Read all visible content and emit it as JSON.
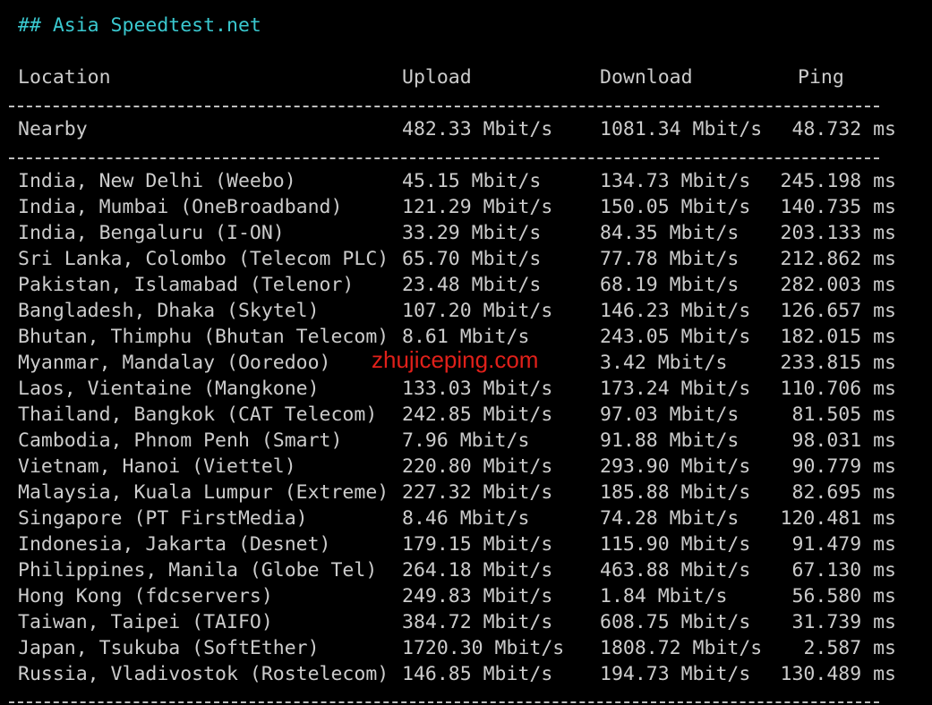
{
  "heading": "## Asia Speedtest.net",
  "columns": {
    "location": "Location",
    "upload": "Upload",
    "download": "Download",
    "ping": "Ping"
  },
  "separator": "---------------------------------------------------------------------------------",
  "nearby": {
    "location": "Nearby",
    "upload": "482.33 Mbit/s",
    "download": "1081.34 Mbit/s",
    "ping": "48.732 ms"
  },
  "rows": [
    {
      "location": "India, New Delhi (Weebo)",
      "upload": "45.15 Mbit/s",
      "download": "134.73 Mbit/s",
      "ping": "245.198 ms"
    },
    {
      "location": "India, Mumbai (OneBroadband)",
      "upload": "121.29 Mbit/s",
      "download": "150.05 Mbit/s",
      "ping": "140.735 ms"
    },
    {
      "location": "India, Bengaluru (I-ON)",
      "upload": "33.29 Mbit/s",
      "download": "84.35 Mbit/s",
      "ping": "203.133 ms"
    },
    {
      "location": "Sri Lanka, Colombo (Telecom PLC)",
      "upload": "65.70 Mbit/s",
      "download": "77.78 Mbit/s",
      "ping": "212.862 ms"
    },
    {
      "location": "Pakistan, Islamabad (Telenor)",
      "upload": "23.48 Mbit/s",
      "download": "68.19 Mbit/s",
      "ping": "282.003 ms"
    },
    {
      "location": "Bangladesh, Dhaka (Skytel)",
      "upload": "107.20 Mbit/s",
      "download": "146.23 Mbit/s",
      "ping": "126.657 ms"
    },
    {
      "location": "Bhutan, Thimphu (Bhutan Telecom)",
      "upload": "8.61 Mbit/s",
      "download": "243.05 Mbit/s",
      "ping": "182.015 ms"
    },
    {
      "location": "Myanmar, Mandalay (Ooredoo)",
      "upload": "",
      "download": "3.42 Mbit/s",
      "ping": "233.815 ms"
    },
    {
      "location": "Laos, Vientaine (Mangkone)",
      "upload": "133.03 Mbit/s",
      "download": "173.24 Mbit/s",
      "ping": "110.706 ms"
    },
    {
      "location": "Thailand, Bangkok (CAT Telecom)",
      "upload": "242.85 Mbit/s",
      "download": "97.03 Mbit/s",
      "ping": "81.505 ms"
    },
    {
      "location": "Cambodia, Phnom Penh (Smart)",
      "upload": "7.96 Mbit/s",
      "download": "91.88 Mbit/s",
      "ping": "98.031 ms"
    },
    {
      "location": "Vietnam, Hanoi (Viettel)",
      "upload": "220.80 Mbit/s",
      "download": "293.90 Mbit/s",
      "ping": "90.779 ms"
    },
    {
      "location": "Malaysia, Kuala Lumpur (Extreme)",
      "upload": "227.32 Mbit/s",
      "download": "185.88 Mbit/s",
      "ping": "82.695 ms"
    },
    {
      "location": "Singapore (PT FirstMedia)",
      "upload": "8.46 Mbit/s",
      "download": "74.28 Mbit/s",
      "ping": "120.481 ms"
    },
    {
      "location": "Indonesia, Jakarta (Desnet)",
      "upload": "179.15 Mbit/s",
      "download": "115.90 Mbit/s",
      "ping": "91.479 ms"
    },
    {
      "location": "Philippines, Manila (Globe Tel)",
      "upload": "264.18 Mbit/s",
      "download": "463.88 Mbit/s",
      "ping": "67.130 ms"
    },
    {
      "location": "Hong Kong (fdcservers)",
      "upload": "249.83 Mbit/s",
      "download": "1.84 Mbit/s",
      "ping": "56.580 ms"
    },
    {
      "location": "Taiwan, Taipei (TAIFO)",
      "upload": "384.72 Mbit/s",
      "download": "608.75 Mbit/s",
      "ping": "31.739 ms"
    },
    {
      "location": "Japan, Tsukuba (SoftEther)",
      "upload": "1720.30 Mbit/s",
      "download": "1808.72 Mbit/s",
      "ping": "2.587 ms"
    },
    {
      "location": "Russia, Vladivostok (Rostelecom)",
      "upload": "146.85 Mbit/s",
      "download": "194.73 Mbit/s",
      "ping": "130.489 ms"
    }
  ],
  "watermark": "zhujiceping.com",
  "colors": {
    "background": "#000000",
    "text": "#cccccc",
    "heading": "#3ac8cf",
    "watermark": "#e0201a"
  }
}
